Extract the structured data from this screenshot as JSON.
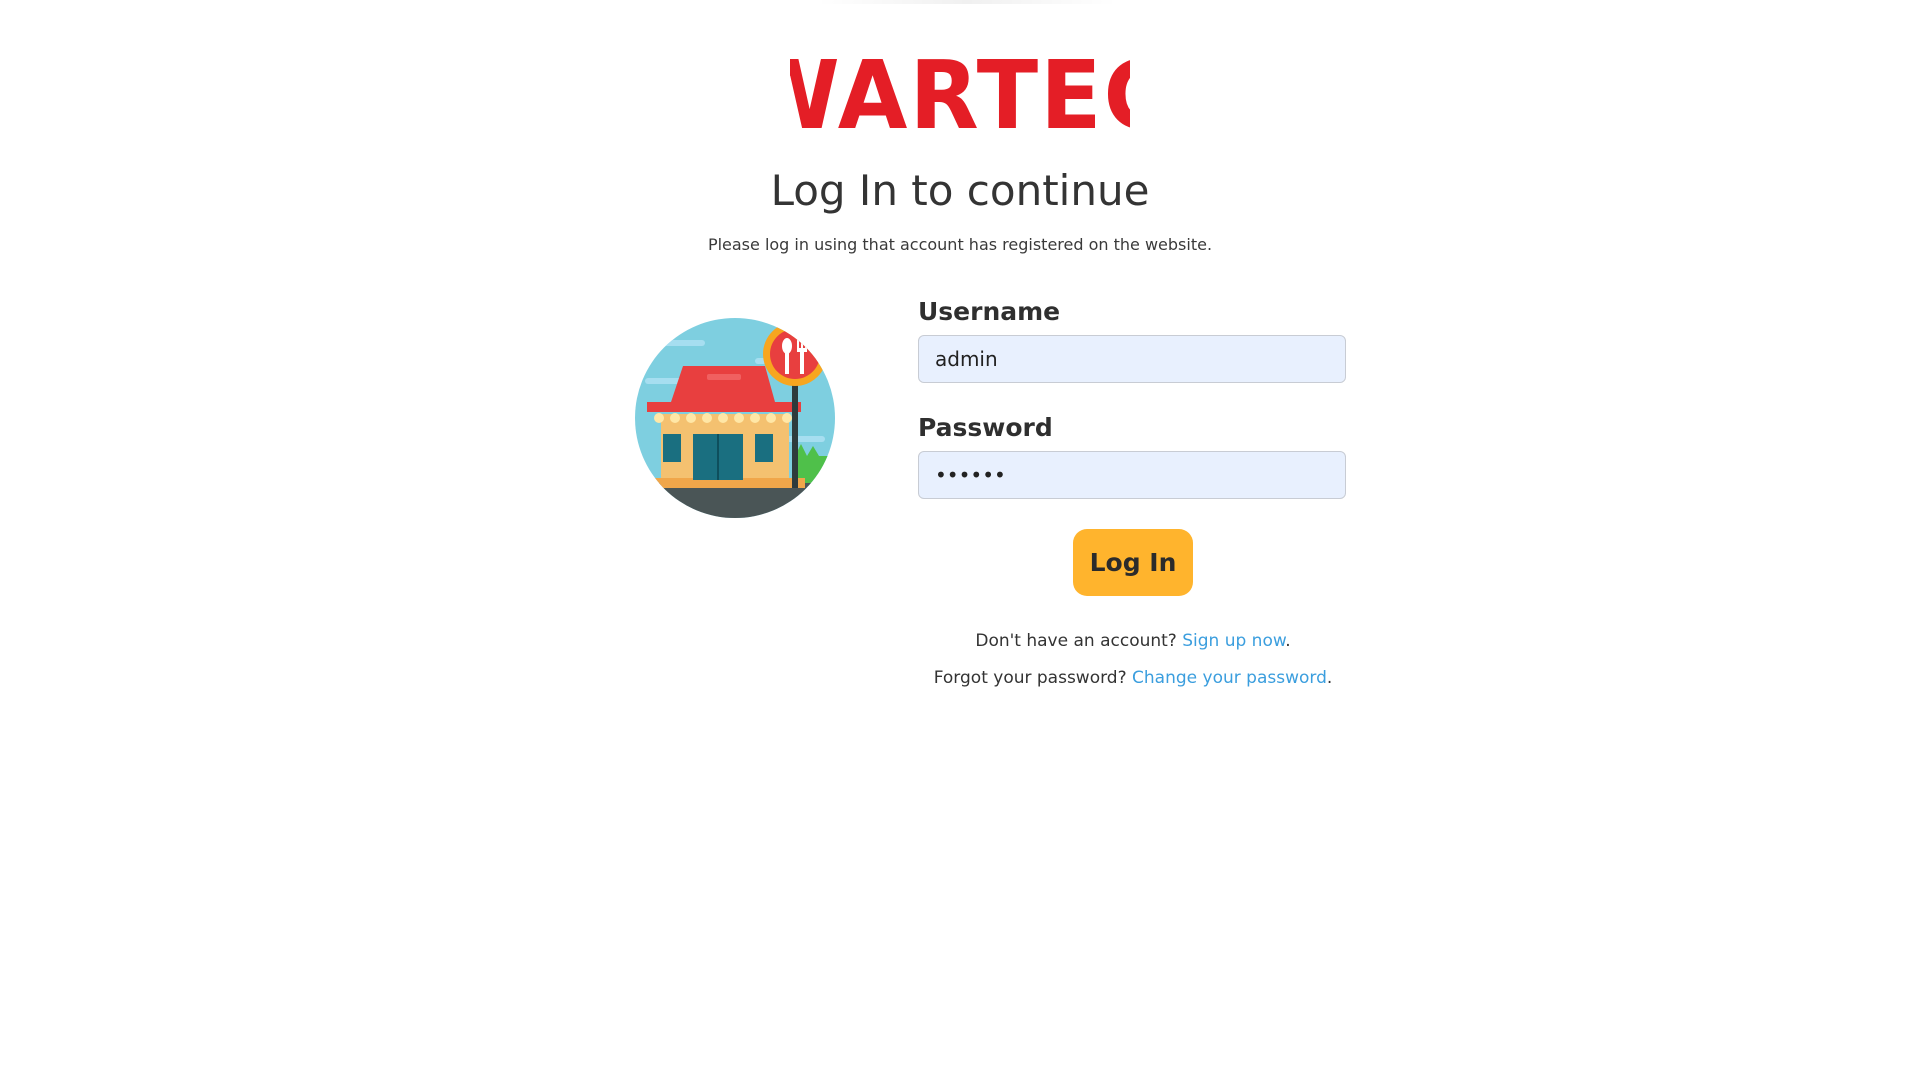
{
  "brand": {
    "name": "WARTEG",
    "color": "#e41e26"
  },
  "heading": {
    "title": "Log In to continue",
    "subtitle": "Please log in using that account has registered on the website."
  },
  "illustration": {
    "icon": "restaurant-storefront-icon"
  },
  "form": {
    "username_label": "Username",
    "username_value": "admin",
    "password_label": "Password",
    "password_value": "••••••",
    "login_button": "Log In"
  },
  "links": {
    "signup_prompt": "Don't have an account? ",
    "signup_link": "Sign up now",
    "signup_suffix": ".",
    "forgot_prompt": "Forgot your password? ",
    "forgot_link": "Change your password",
    "forgot_suffix": "."
  },
  "colors": {
    "button": "#ffb42d",
    "link": "#3b9ede",
    "input_bg": "#e8f0fe"
  }
}
